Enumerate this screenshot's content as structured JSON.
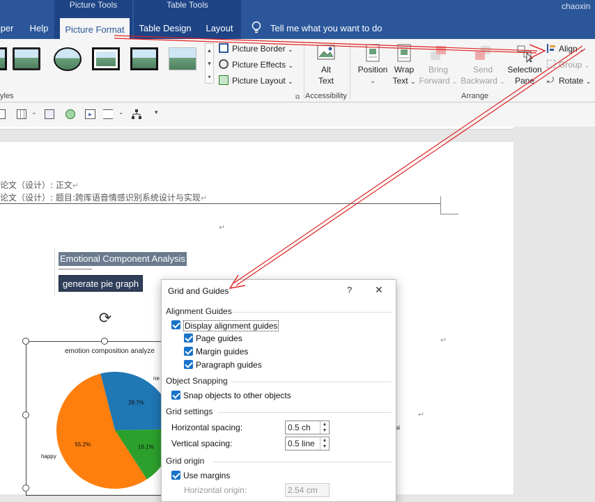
{
  "titlebar": {
    "user": "chaoxin",
    "context_groups": [
      {
        "label": "Picture Tools"
      },
      {
        "label": "Table Tools"
      }
    ],
    "tabs": [
      {
        "label": "per"
      },
      {
        "label": "Help"
      },
      {
        "label": "Picture Format"
      },
      {
        "label": "Table Design"
      },
      {
        "label": "Layout"
      }
    ],
    "tell_me": "Tell me what you want to do"
  },
  "ribbon": {
    "picture_styles_group_label": "yles",
    "picture_border": "Picture Border",
    "picture_effects": "Picture Effects",
    "picture_layout": "Picture Layout",
    "alt_text": [
      "Alt",
      "Text"
    ],
    "accessibility_label": "Accessibility",
    "position": "Position",
    "wrap_text": [
      "Wrap",
      "Text"
    ],
    "bring_forward": [
      "Bring",
      "Forward"
    ],
    "send_backward": [
      "Send",
      "Backward"
    ],
    "selection_pane": [
      "Selection",
      "Pane"
    ],
    "align": "Align",
    "group": "Group",
    "rotate": "Rotate",
    "arrange_label": "Arrange"
  },
  "document": {
    "header_line1": "论文（设计）: 正文",
    "header_line2": "论文（设计）: 题目:跨库语音情感识别系统设计与实现",
    "paragraph_mark": "↵",
    "heading_text": "Emotional Component Analysis",
    "button_text": "generate pie graph",
    "chart_title": "emotion composition analyze",
    "legend_fragment_ne": "ne",
    "legend_fragment_ral": "ral"
  },
  "chart_data": {
    "type": "pie",
    "title": "emotion composition analyze",
    "labels": [
      "happy",
      "ne",
      "",
      "ral"
    ],
    "slices": [
      {
        "label": "happy",
        "value": 55.2,
        "value_label": "55.2%",
        "color": "#ff7f0e"
      },
      {
        "label": "ne",
        "value": 28.7,
        "value_label": "28.7%",
        "color": "#1f77b4"
      },
      {
        "label": "",
        "value": 16.1,
        "value_label": "16.1%",
        "color": "#2ca02c"
      }
    ]
  },
  "dialog": {
    "title": "Grid and Guides",
    "help": "?",
    "close": "✕",
    "alignment_guides_header": "Alignment Guides",
    "display_alignment_guides": "Display alignment guides",
    "page_guides": "Page guides",
    "margin_guides": "Margin guides",
    "paragraph_guides": "Paragraph guides",
    "object_snapping_header": "Object Snapping",
    "snap_objects": "Snap objects to other objects",
    "grid_settings_header": "Grid settings",
    "horizontal_spacing_label": "Horizontal spacing:",
    "horizontal_spacing_value": "0.5 ch",
    "vertical_spacing_label": "Vertical spacing:",
    "vertical_spacing_value": "0.5 line",
    "grid_origin_header": "Grid origin",
    "use_margins": "Use margins",
    "horizontal_origin_label": "Horizontal origin:",
    "horizontal_origin_value": "2.54 cm"
  },
  "colors": {
    "title_bar": "#2b579a",
    "annotation_arrow": "#e02020",
    "checkbox": "#1a73c9"
  }
}
